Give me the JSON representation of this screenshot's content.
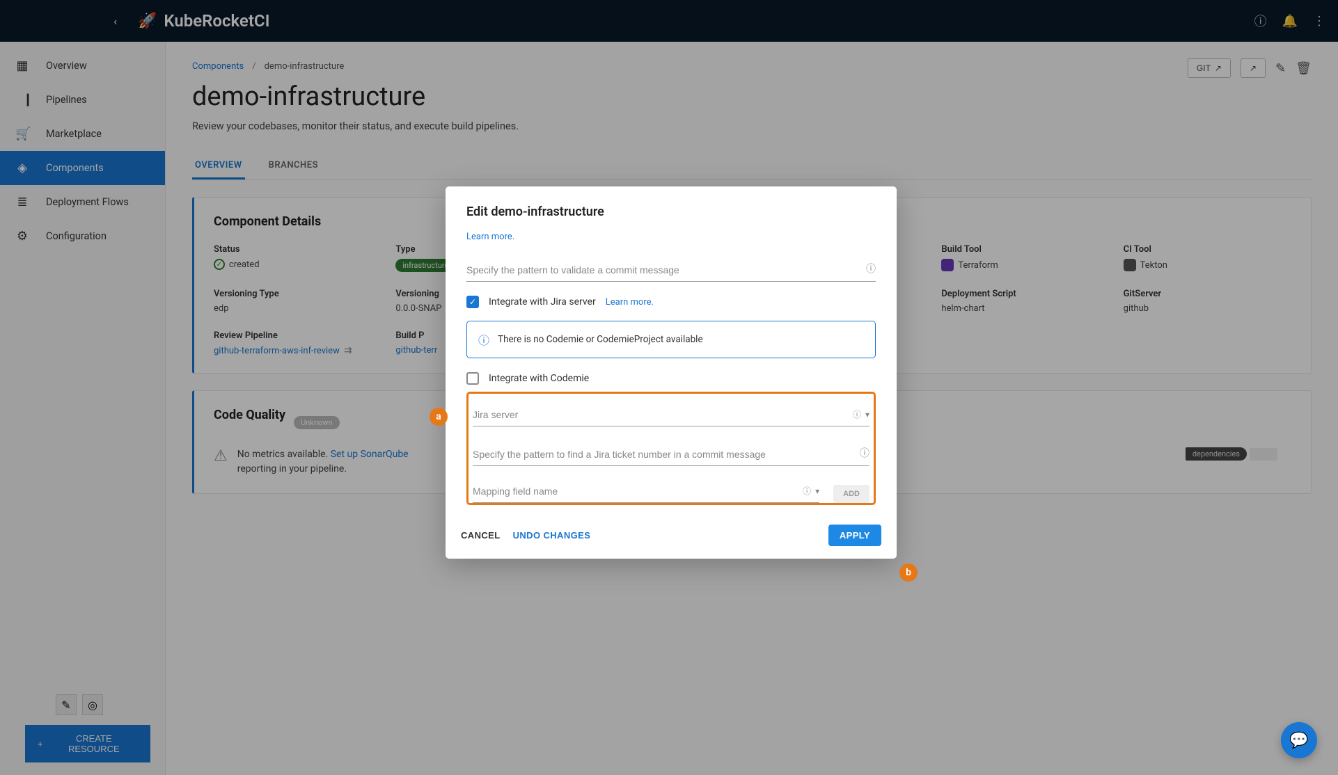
{
  "app": {
    "name": "KubeRocketCI"
  },
  "sidebar": {
    "items": [
      {
        "label": "Overview",
        "icon": "▦"
      },
      {
        "label": "Pipelines",
        "icon": "⎹⎸"
      },
      {
        "label": "Marketplace",
        "icon": "🛒"
      },
      {
        "label": "Components",
        "icon": "◈"
      },
      {
        "label": "Deployment Flows",
        "icon": "≣"
      },
      {
        "label": "Configuration",
        "icon": "⚙"
      }
    ],
    "create_label": "CREATE RESOURCE"
  },
  "breadcrumb": {
    "parent": "Components",
    "current": "demo-infrastructure"
  },
  "page": {
    "title": "demo-infrastructure",
    "subtitle": "Review your codebases, monitor their status, and execute build pipelines.",
    "actions": {
      "git": "GIT"
    }
  },
  "tabs": [
    {
      "label": "OVERVIEW",
      "active": true
    },
    {
      "label": "BRANCHES",
      "active": false
    }
  ],
  "details": {
    "title": "Component Details",
    "rows": [
      [
        {
          "label": "Status",
          "value": "created",
          "type": "status"
        },
        {
          "label": "Type",
          "value": "infrastructure",
          "type": "badge"
        },
        {
          "label": "",
          "value": ""
        },
        {
          "label": "",
          "value": ""
        },
        {
          "label": "Build Tool",
          "value": "Terraform",
          "type": "tool"
        },
        {
          "label": "CI Tool",
          "value": "Tekton",
          "type": "tool"
        }
      ],
      [
        {
          "label": "Versioning Type",
          "value": "edp"
        },
        {
          "label": "Versioning",
          "value": "0.0.0-SNAP"
        },
        {
          "label": "",
          "value": ""
        },
        {
          "label": "",
          "value": ""
        },
        {
          "label": "Deployment Script",
          "value": "helm-chart"
        },
        {
          "label": "GitServer",
          "value": "github"
        }
      ],
      [
        {
          "label": "Review Pipeline",
          "value": "github-terraform-aws-inf-review",
          "type": "link"
        },
        {
          "label": "Build P",
          "value": "github-terr",
          "type": "link"
        },
        {
          "label": "",
          "value": ""
        },
        {
          "label": "",
          "value": ""
        },
        {
          "label": "",
          "value": ""
        },
        {
          "label": "",
          "value": ""
        }
      ]
    ]
  },
  "quality": {
    "title": "Code Quality",
    "badge": "Unknown",
    "msg_prefix": "No metrics available.",
    "link": "Set up SonarQube",
    "msg_suffix": "reporting in your pipeline.",
    "deps_badge": "dependencies"
  },
  "dialog": {
    "title": "Edit demo-infrastructure",
    "learn_more": "Learn more.",
    "commit_placeholder": "Specify the pattern to validate a commit message",
    "jira_check": "Integrate with Jira server",
    "jira_learn": "Learn more.",
    "alert": "There is no Codemie or CodemieProject available",
    "codemie_check": "Integrate with Codemie",
    "jira_server_placeholder": "Jira server",
    "ticket_placeholder": "Specify the pattern to find a Jira ticket number in a commit message",
    "mapping_placeholder": "Mapping field name",
    "add_btn": "ADD",
    "cancel": "CANCEL",
    "undo": "UNDO CHANGES",
    "apply": "APPLY"
  },
  "markers": {
    "a": "a",
    "b": "b"
  }
}
